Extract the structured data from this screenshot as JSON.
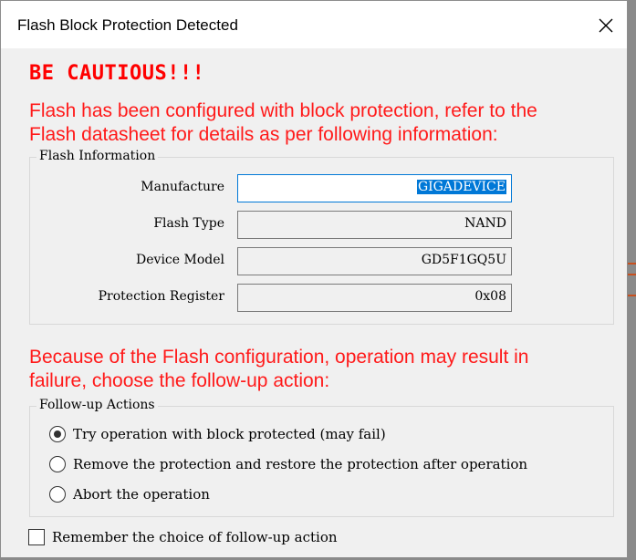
{
  "window": {
    "title": "Flash Block Protection Detected"
  },
  "caution": "BE CAUTIOUS!!!",
  "warning1": {
    "line1": "Flash has been configured with block protection, refer to the",
    "line2": "Flash datasheet for details as per following information:"
  },
  "flash_info": {
    "legend": "Flash Information",
    "rows": [
      {
        "label": "Manufacture",
        "value": "GIGADEVICE"
      },
      {
        "label": "Flash Type",
        "value": "NAND"
      },
      {
        "label": "Device Model",
        "value": "GD5F1GQ5U"
      },
      {
        "label": "Protection Register",
        "value": "0x08"
      }
    ]
  },
  "warning2": {
    "line1": "Because of the Flash configuration, operation may result in",
    "line2": "failure, choose the follow-up action:"
  },
  "actions": {
    "legend": "Follow-up Actions",
    "options": [
      {
        "label": "Try operation with block protected (may fail)",
        "selected": true
      },
      {
        "label": "Remove the protection and restore the protection after operation",
        "selected": false
      },
      {
        "label": "Abort the operation",
        "selected": false
      }
    ]
  },
  "remember": {
    "label": "Remember the choice of follow-up action",
    "checked": false
  },
  "colors": {
    "warning": "#ff0000",
    "focus": "#0078d7"
  }
}
